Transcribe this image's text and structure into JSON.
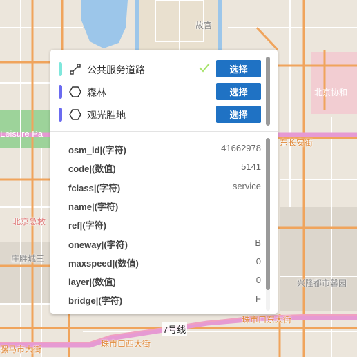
{
  "map": {
    "labels": {
      "palace": "故宫",
      "leisure": "Leisure Pa",
      "peking_union": "北京协和",
      "east_changan": "东长安街",
      "beijing_xi": "北京急救",
      "zhuangsheng": "庄胜城三",
      "xinglong": "兴隆都市馨园",
      "zhushikou_e": "珠市口东大街",
      "zhushikou_w": "珠市口西大街",
      "luomashi": "骡马市大街",
      "line7": "7号线"
    }
  },
  "layers": {
    "items": [
      {
        "label": "公共服务道路",
        "color": "#7fe7dc",
        "icon": "polyline-icon",
        "checked": true,
        "button": "选择"
      },
      {
        "label": "森林",
        "color": "#6b6bf0",
        "icon": "hexagon-icon",
        "checked": false,
        "button": "选择"
      },
      {
        "label": "观光胜地",
        "color": "#6b6bf0",
        "icon": "hexagon-icon",
        "checked": false,
        "button": "选择"
      }
    ],
    "check_color": "#a6e36a",
    "button_color": "#1f72c4"
  },
  "attributes": {
    "rows": [
      {
        "key": "osm_id|(字符)",
        "value": "41662978"
      },
      {
        "key": "code|(数值)",
        "value": "5141"
      },
      {
        "key": "fclass|(字符)",
        "value": "service"
      },
      {
        "key": "name|(字符)",
        "value": ""
      },
      {
        "key": "ref|(字符)",
        "value": ""
      },
      {
        "key": "oneway|(字符)",
        "value": "B"
      },
      {
        "key": "maxspeed|(数值)",
        "value": "0"
      },
      {
        "key": "layer|(数值)",
        "value": "0"
      },
      {
        "key": "bridge|(字符)",
        "value": "F"
      }
    ]
  }
}
